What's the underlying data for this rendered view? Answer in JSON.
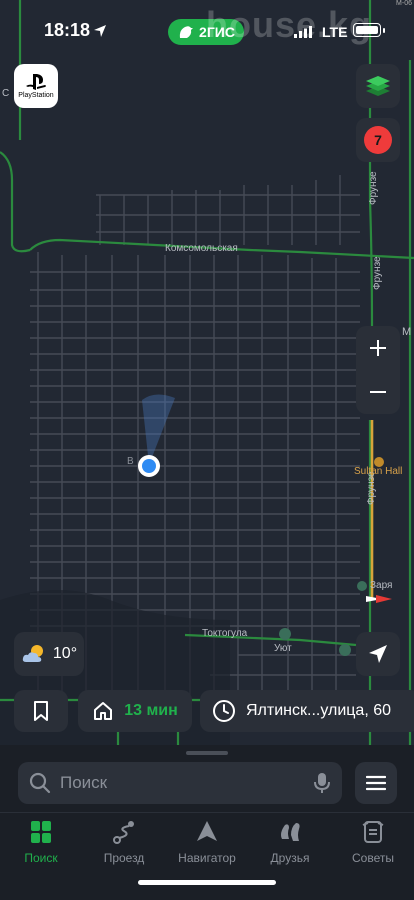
{
  "status_bar": {
    "time": "18:18",
    "network": "LTE",
    "app_brand": "2ГИС",
    "watermark": "house.kg",
    "corner_label": "М-06"
  },
  "map": {
    "labels": {
      "komsomolskaya": "Комсомольская",
      "toktogula": "Токтогула",
      "frunze_1": "Фрунзе",
      "frunze_2": "Фрунзе",
      "frunze_3": "Фрунзе",
      "sultan_hall": "Sultan Hall",
      "uyut": "Уют",
      "zarya": "Заря",
      "m_label": "М",
      "s_label": "С",
      "v_label": "В"
    },
    "traffic_score": "7",
    "sponsor_label": "PlayStation",
    "accent_color": "#20b14c",
    "traffic_color": "#ef3b3b"
  },
  "weather": {
    "temperature": "10°",
    "icon": "partly-cloudy-icon"
  },
  "quick_actions": {
    "home_minutes": "13 мин",
    "recent_address": "Ялтинск...улица, 60"
  },
  "search": {
    "placeholder": "Поиск"
  },
  "tabs": [
    {
      "label": "Поиск",
      "icon": "search-grid-icon",
      "active": true
    },
    {
      "label": "Проезд",
      "icon": "route-icon",
      "active": false
    },
    {
      "label": "Навигатор",
      "icon": "navigator-icon",
      "active": false
    },
    {
      "label": "Друзья",
      "icon": "friends-icon",
      "active": false
    },
    {
      "label": "Советы",
      "icon": "tips-icon",
      "active": false
    }
  ]
}
